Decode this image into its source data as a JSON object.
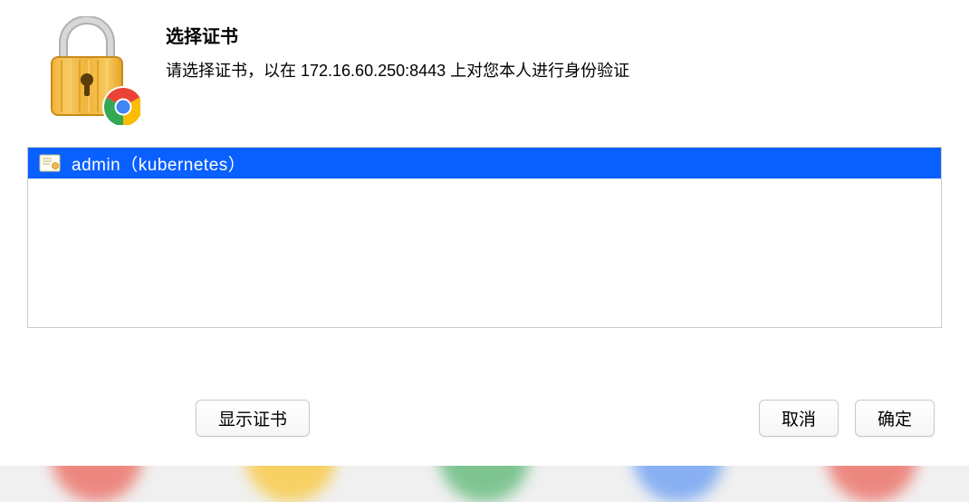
{
  "dialog": {
    "title": "选择证书",
    "subtitle": "请选择证书，以在 172.16.60.250:8443 上对您本人进行身份验证"
  },
  "certificates": {
    "items": [
      {
        "label": "admin（kubernetes）"
      }
    ]
  },
  "buttons": {
    "show_cert": "显示证书",
    "cancel": "取消",
    "ok": "确定"
  }
}
